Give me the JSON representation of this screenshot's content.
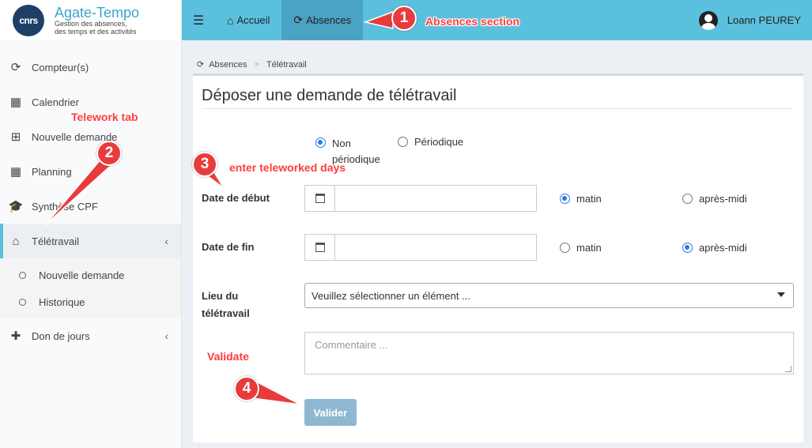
{
  "brand": {
    "logo_text": "cnrs",
    "title": "Agate-Tempo",
    "subtitle_1": "Gestion des absences,",
    "subtitle_2": "des temps et des activités"
  },
  "topnav": {
    "home": "Accueil",
    "absences": "Absences",
    "user_name": "Loann PEUREY"
  },
  "sidebar": {
    "items": [
      {
        "label": "Compteur(s)",
        "icon": "refresh-icon"
      },
      {
        "label": "Calendrier",
        "icon": "calendar-icon"
      },
      {
        "label": "Nouvelle demande",
        "icon": "calendar-plus-icon"
      },
      {
        "label": "Planning",
        "icon": "calendar-icon"
      },
      {
        "label": "Synthèse CPF",
        "icon": "graduation-cap-icon"
      },
      {
        "label": "Télétravail",
        "icon": "home-icon"
      },
      {
        "label": "Don de jours",
        "icon": "medkit-icon"
      }
    ],
    "subitems": [
      "Nouvelle demande",
      "Historique"
    ]
  },
  "breadcrumb": {
    "items": [
      "Absences",
      "Télétravail"
    ],
    "separator": ">"
  },
  "form": {
    "title": "Déposer une demande de télétravail",
    "type_options": {
      "non_periodique_1": "Non",
      "non_periodique_2": "périodique",
      "periodique": "Périodique",
      "selected": "Non périodique"
    },
    "start_date": {
      "label": "Date de début",
      "value": "",
      "period_am": "matin",
      "period_pm": "après-midi",
      "selected": "matin"
    },
    "end_date": {
      "label": "Date de fin",
      "value": "",
      "period_am": "matin",
      "period_pm": "après-midi",
      "selected": "après-midi"
    },
    "location": {
      "label_1": "Lieu du",
      "label_2": "télétravail",
      "value": "Veuillez sélectionner un élément ..."
    },
    "comment": {
      "placeholder": "Commentaire ..."
    },
    "submit": "Valider"
  },
  "annotations": {
    "a1": {
      "num": "1",
      "text": "Absences section"
    },
    "a2": {
      "num": "2",
      "text": "Telework tab"
    },
    "a3": {
      "num": "3",
      "text": "enter teleworked days"
    },
    "a4": {
      "num": "4",
      "text": "Validate"
    }
  },
  "colors": {
    "accent": "#5bc0de",
    "annotation": "#e83c3c",
    "button": "#8fb7d1"
  }
}
